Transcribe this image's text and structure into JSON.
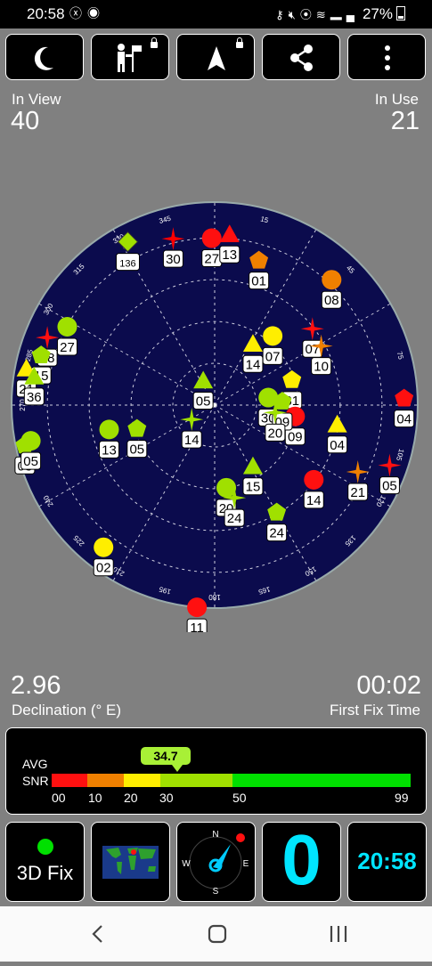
{
  "status_bar": {
    "time": "20:58",
    "left_icons": [
      "x-icon",
      "camera-icon"
    ],
    "right_icons": [
      "key-icon",
      "mute-icon",
      "location-icon",
      "wifi-icon",
      "call-icon",
      "signal-icon"
    ],
    "battery": "27%"
  },
  "toolbar": {
    "buttons": [
      "night-mode-icon",
      "survey-icon",
      "navigation-icon",
      "share-icon",
      "more-icon"
    ]
  },
  "stats": {
    "in_view_label": "In View",
    "in_view_value": "40",
    "in_use_label": "In Use",
    "in_use_value": "21",
    "declination_value": "2.96",
    "declination_label": "Declination (° E)",
    "first_fix_value": "00:02",
    "first_fix_label": "First Fix Time"
  },
  "sky_plot": {
    "elevation_rings": 4,
    "azimuth_ticks": [
      "15",
      "45",
      "75",
      "105",
      "120",
      "135",
      "150",
      "165",
      "180",
      "195",
      "210",
      "225",
      "240",
      "255",
      "270",
      "285",
      "300",
      "315",
      "330",
      "345"
    ],
    "satellites": [
      {
        "id": "136",
        "az": 332,
        "el": 8,
        "shape": "diamond",
        "color": "#a0e000"
      },
      {
        "id": "30",
        "az": 346,
        "el": 14,
        "shape": "star",
        "color": "#ff0000"
      },
      {
        "id": "27",
        "az": 359,
        "el": 16,
        "shape": "circle",
        "color": "#ff1010"
      },
      {
        "id": "13",
        "az": 5,
        "el": 14,
        "shape": "triangle",
        "color": "#ff1010"
      },
      {
        "id": "01",
        "az": 17,
        "el": 23,
        "shape": "pentagon",
        "color": "#f08000"
      },
      {
        "id": "08",
        "az": 43,
        "el": 14,
        "shape": "circle",
        "color": "#f08000"
      },
      {
        "id": "07",
        "az": 52,
        "el": 35,
        "shape": "star",
        "color": "#ff1010"
      },
      {
        "id": "10",
        "az": 61,
        "el": 36,
        "shape": "star",
        "color": "#f08000"
      },
      {
        "id": "07",
        "az": 40,
        "el": 50,
        "shape": "circle",
        "color": "#ffee00"
      },
      {
        "id": "14",
        "az": 32,
        "el": 58,
        "shape": "triangle",
        "color": "#ffee00"
      },
      {
        "id": "31",
        "az": 72,
        "el": 54,
        "shape": "pentagon",
        "color": "#ffee00"
      },
      {
        "id": "09",
        "az": 98,
        "el": 54,
        "shape": "circle",
        "color": "#ff1010"
      },
      {
        "id": "04",
        "az": 88,
        "el": 6,
        "shape": "pentagon",
        "color": "#ff1010"
      },
      {
        "id": "05",
        "az": 109,
        "el": 8,
        "shape": "star",
        "color": "#ff1010"
      },
      {
        "id": "04",
        "az": 99,
        "el": 35,
        "shape": "triangle",
        "color": "#ffee00"
      },
      {
        "id": "21",
        "az": 115,
        "el": 20,
        "shape": "star",
        "color": "#f08000"
      },
      {
        "id": "14",
        "az": 127,
        "el": 35,
        "shape": "circle",
        "color": "#ff1010"
      },
      {
        "id": "30",
        "az": 82,
        "el": 66,
        "shape": "circle",
        "color": "#a0e000"
      },
      {
        "id": "09",
        "az": 87,
        "el": 60,
        "shape": "pentagon",
        "color": "#a0e000"
      },
      {
        "id": "20",
        "az": 97,
        "el": 63,
        "shape": "star",
        "color": "#a0e000"
      },
      {
        "id": "15",
        "az": 148,
        "el": 58,
        "shape": "triangle",
        "color": "#a0e000"
      },
      {
        "id": "24",
        "az": 150,
        "el": 35,
        "shape": "pentagon",
        "color": "#a0e000"
      },
      {
        "id": "20",
        "az": 172,
        "el": 53,
        "shape": "circle",
        "color": "#a0e000"
      },
      {
        "id": "24",
        "az": 168,
        "el": 48,
        "shape": "star",
        "color": "#a0e000"
      },
      {
        "id": "02",
        "az": 218,
        "el": 10,
        "shape": "circle",
        "color": "#ffee00"
      },
      {
        "id": "11",
        "az": 185,
        "el": 0,
        "shape": "circle",
        "color": "#ff1010"
      },
      {
        "id": "05",
        "az": 335,
        "el": 78,
        "shape": "triangle",
        "color": "#a0e000"
      },
      {
        "id": "14",
        "az": 238,
        "el": 78,
        "shape": "star",
        "color": "#a0e000"
      },
      {
        "id": "05",
        "az": 253,
        "el": 54,
        "shape": "pentagon",
        "color": "#a0e000"
      },
      {
        "id": "13",
        "az": 257,
        "el": 42,
        "shape": "circle",
        "color": "#a0e000"
      },
      {
        "id": "27",
        "az": 298,
        "el": 16,
        "shape": "circle",
        "color": "#a0e000"
      },
      {
        "id": "28",
        "az": 292,
        "el": 10,
        "shape": "star",
        "color": "#ff1010"
      },
      {
        "id": "15",
        "az": 286,
        "el": 10,
        "shape": "pentagon",
        "color": "#a0e000"
      },
      {
        "id": "21",
        "az": 281,
        "el": 5,
        "shape": "triangle",
        "color": "#ffee00"
      },
      {
        "id": "36",
        "az": 279,
        "el": 9,
        "shape": "triangle",
        "color": "#a0e000"
      },
      {
        "id": "03",
        "az": 258,
        "el": 4,
        "shape": "pentagon",
        "color": "#a0e000"
      },
      {
        "id": "05",
        "az": 259,
        "el": 7,
        "shape": "circle",
        "color": "#a0e000"
      }
    ]
  },
  "snr": {
    "avg_label": "AVG",
    "snr_label": "SNR",
    "value": "34.7",
    "ticks": [
      "00",
      "10",
      "20",
      "30",
      "50",
      "99"
    ]
  },
  "bottom_panel": {
    "fix_label": "3D Fix",
    "fix_color": "#00e000",
    "sat_count": "0",
    "clock": "20:58",
    "compass_n": "N",
    "compass_e": "E",
    "compass_s": "S",
    "compass_w": "W"
  },
  "navigation": [
    "back-icon",
    "home-icon",
    "recents-icon"
  ]
}
